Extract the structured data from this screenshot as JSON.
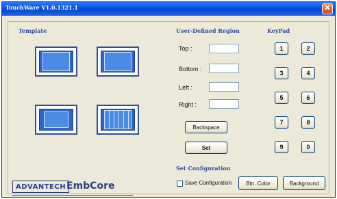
{
  "window": {
    "title": "TouchWare V1.0.1321.1",
    "close_glyph": "✕"
  },
  "template": {
    "label": "Template",
    "items": [
      {
        "name": "single-border"
      },
      {
        "name": "single-border-alt"
      },
      {
        "name": "double-border"
      },
      {
        "name": "grid-border"
      }
    ]
  },
  "region": {
    "label": "User-Defined Region",
    "top_label": "Top :",
    "top_value": "",
    "bottom_label": "Bottom :",
    "bottom_value": "",
    "left_label": "Left :",
    "left_value": "",
    "right_label": "Right :",
    "right_value": "",
    "backspace_label": "Backspace",
    "set_label": "Set"
  },
  "keypad": {
    "label": "KeyPad",
    "keys": [
      "1",
      "2",
      "3",
      "4",
      "5",
      "6",
      "7",
      "8",
      "9",
      "0"
    ]
  },
  "config": {
    "label": "Set Configuration",
    "save_label": "Save Configuration",
    "save_checked": false,
    "btn_color_label": "Btn. Color",
    "background_label": "Background"
  },
  "logo": {
    "brand": "ADVANTECH",
    "product": "EmbCore"
  },
  "colors": {
    "titlebar": "#0a52e0",
    "section_label": "#2a4fa0",
    "template_blue": "#2b66c8",
    "logo": "#2a3f86",
    "close_button": "#d8451e"
  }
}
